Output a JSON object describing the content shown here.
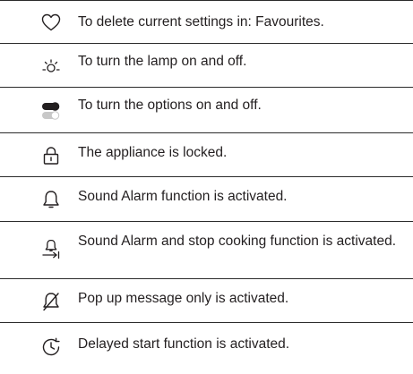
{
  "rows": [
    {
      "icon": "heart-outline-icon",
      "text": "To delete current settings in: Favourites."
    },
    {
      "icon": "lamp-icon",
      "text": "To turn the lamp on and off."
    },
    {
      "icon": "toggle-switch-icon",
      "text": "To turn the options on and off."
    },
    {
      "icon": "padlock-icon",
      "text": "The appliance is locked."
    },
    {
      "icon": "bell-icon",
      "text": "Sound Alarm function is activated."
    },
    {
      "icon": "bell-stop-arrow-icon",
      "text": "Sound Alarm and stop cooking function is activated."
    },
    {
      "icon": "bell-crossed-icon",
      "text": "Pop up message only is activated."
    },
    {
      "icon": "delayed-start-clock-icon",
      "text": "Delayed start function is activated."
    }
  ]
}
